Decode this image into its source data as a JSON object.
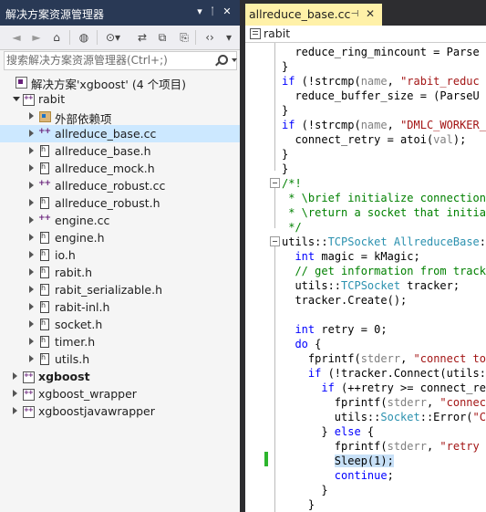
{
  "solution_explorer": {
    "title": "解决方案资源管理器",
    "search_placeholder": "搜索解决方案资源管理器(Ctrl+;)",
    "tree": [
      {
        "label": "解决方案'xgboost' (4 个项目)",
        "icon": "solution-icon",
        "indent": 0,
        "state": "none",
        "bold": false,
        "selected": false
      },
      {
        "label": "rabit",
        "icon": "cpp-project-icon",
        "indent": 1,
        "state": "expanded",
        "bold": false,
        "selected": false
      },
      {
        "label": "外部依赖项",
        "icon": "external-dependencies-icon",
        "indent": 2,
        "state": "collapsed",
        "bold": false,
        "selected": false
      },
      {
        "label": "allreduce_base.cc",
        "icon": "cpp-source-icon",
        "indent": 2,
        "state": "collapsed",
        "bold": false,
        "selected": true
      },
      {
        "label": "allreduce_base.h",
        "icon": "header-file-icon",
        "indent": 2,
        "state": "collapsed",
        "bold": false,
        "selected": false
      },
      {
        "label": "allreduce_mock.h",
        "icon": "header-file-icon",
        "indent": 2,
        "state": "collapsed",
        "bold": false,
        "selected": false
      },
      {
        "label": "allreduce_robust.cc",
        "icon": "cpp-source-icon",
        "indent": 2,
        "state": "collapsed",
        "bold": false,
        "selected": false
      },
      {
        "label": "allreduce_robust.h",
        "icon": "header-file-icon",
        "indent": 2,
        "state": "collapsed",
        "bold": false,
        "selected": false
      },
      {
        "label": "engine.cc",
        "icon": "cpp-source-icon",
        "indent": 2,
        "state": "collapsed",
        "bold": false,
        "selected": false
      },
      {
        "label": "engine.h",
        "icon": "header-file-icon",
        "indent": 2,
        "state": "collapsed",
        "bold": false,
        "selected": false
      },
      {
        "label": "io.h",
        "icon": "header-file-icon",
        "indent": 2,
        "state": "collapsed",
        "bold": false,
        "selected": false
      },
      {
        "label": "rabit.h",
        "icon": "header-file-icon",
        "indent": 2,
        "state": "collapsed",
        "bold": false,
        "selected": false
      },
      {
        "label": "rabit_serializable.h",
        "icon": "header-file-icon",
        "indent": 2,
        "state": "collapsed",
        "bold": false,
        "selected": false
      },
      {
        "label": "rabit-inl.h",
        "icon": "header-file-icon",
        "indent": 2,
        "state": "collapsed",
        "bold": false,
        "selected": false
      },
      {
        "label": "socket.h",
        "icon": "header-file-icon",
        "indent": 2,
        "state": "collapsed",
        "bold": false,
        "selected": false
      },
      {
        "label": "timer.h",
        "icon": "header-file-icon",
        "indent": 2,
        "state": "collapsed",
        "bold": false,
        "selected": false
      },
      {
        "label": "utils.h",
        "icon": "header-file-icon",
        "indent": 2,
        "state": "collapsed",
        "bold": false,
        "selected": false
      },
      {
        "label": "xgboost",
        "icon": "cpp-project-icon",
        "indent": 1,
        "state": "collapsed",
        "bold": true,
        "selected": false
      },
      {
        "label": "xgboost_wrapper",
        "icon": "cpp-project-icon",
        "indent": 1,
        "state": "collapsed",
        "bold": false,
        "selected": false
      },
      {
        "label": "xgboostjavawrapper",
        "icon": "cpp-project-icon",
        "indent": 1,
        "state": "collapsed",
        "bold": false,
        "selected": false
      }
    ]
  },
  "editor": {
    "tab_label": "allreduce_base.cc",
    "nav_scope": "rabit",
    "code_lines": [
      [
        {
          "t": "  reduce_ring_mincount = Parse"
        }
      ],
      [
        {
          "t": "}"
        }
      ],
      [
        {
          "t": "if",
          "c": "kw"
        },
        {
          "t": " (!strcmp("
        },
        {
          "t": "name",
          "c": "pm"
        },
        {
          "t": ", "
        },
        {
          "t": "\"rabit_reduc",
          "c": "st"
        }
      ],
      [
        {
          "t": "  reduce_buffer_size = (ParseU"
        }
      ],
      [
        {
          "t": "}"
        }
      ],
      [
        {
          "t": "if",
          "c": "kw"
        },
        {
          "t": " (!strcmp("
        },
        {
          "t": "name",
          "c": "pm"
        },
        {
          "t": ", "
        },
        {
          "t": "\"DMLC_WORKER_",
          "c": "st"
        }
      ],
      [
        {
          "t": "  connect_retry = atoi("
        },
        {
          "t": "val",
          "c": "pm"
        },
        {
          "t": ");"
        }
      ],
      [
        {
          "t": "}"
        }
      ],
      [
        {
          "t": "}"
        }
      ],
      [
        {
          "t": "/*!",
          "c": "cm"
        }
      ],
      [
        {
          "t": " * \\brief initialize connection t",
          "c": "cm"
        }
      ],
      [
        {
          "t": " * \\return a socket that initial",
          "c": "cm"
        }
      ],
      [
        {
          "t": " */",
          "c": "cm"
        }
      ],
      [
        {
          "t": "utils::"
        },
        {
          "t": "TCPSocket",
          "c": "ty"
        },
        {
          "t": " "
        },
        {
          "t": "AllreduceBase",
          "c": "ty"
        },
        {
          "t": "::C"
        }
      ],
      [
        {
          "t": "  "
        },
        {
          "t": "int",
          "c": "kw"
        },
        {
          "t": " magic = kMagic;"
        }
      ],
      [
        {
          "t": "  "
        },
        {
          "t": "// get information from tracke",
          "c": "cm"
        }
      ],
      [
        {
          "t": "  utils::"
        },
        {
          "t": "TCPSocket",
          "c": "ty"
        },
        {
          "t": " tracker;"
        }
      ],
      [
        {
          "t": "  tracker.Create();"
        }
      ],
      [
        {
          "t": ""
        }
      ],
      [
        {
          "t": "  "
        },
        {
          "t": "int",
          "c": "kw"
        },
        {
          "t": " retry = 0;"
        }
      ],
      [
        {
          "t": "  "
        },
        {
          "t": "do",
          "c": "kw"
        },
        {
          "t": " {"
        }
      ],
      [
        {
          "t": "    fprintf("
        },
        {
          "t": "stderr",
          "c": "pm"
        },
        {
          "t": ", "
        },
        {
          "t": "\"connect to",
          "c": "st"
        }
      ],
      [
        {
          "t": "    "
        },
        {
          "t": "if",
          "c": "kw"
        },
        {
          "t": " (!tracker.Connect(utils::"
        }
      ],
      [
        {
          "t": "      "
        },
        {
          "t": "if",
          "c": "kw"
        },
        {
          "t": " (++retry >= connect_ret"
        }
      ],
      [
        {
          "t": "        fprintf("
        },
        {
          "t": "stderr",
          "c": "pm"
        },
        {
          "t": ", "
        },
        {
          "t": "\"connect",
          "c": "st"
        }
      ],
      [
        {
          "t": "        utils::"
        },
        {
          "t": "Socket",
          "c": "ty"
        },
        {
          "t": "::Error("
        },
        {
          "t": "\"Co",
          "c": "st"
        }
      ],
      [
        {
          "t": "      } "
        },
        {
          "t": "else",
          "c": "kw"
        },
        {
          "t": " {"
        }
      ],
      [
        {
          "t": "        fprintf("
        },
        {
          "t": "stderr",
          "c": "pm"
        },
        {
          "t": ", "
        },
        {
          "t": "\"retry c",
          "c": "st"
        }
      ],
      [
        {
          "t": "        "
        },
        {
          "t": "Sleep(1);",
          "c": "hl"
        }
      ],
      [
        {
          "t": "        "
        },
        {
          "t": "continue",
          "c": "kw"
        },
        {
          "t": ";"
        }
      ],
      [
        {
          "t": "      }"
        }
      ],
      [
        {
          "t": "    }"
        }
      ]
    ]
  }
}
